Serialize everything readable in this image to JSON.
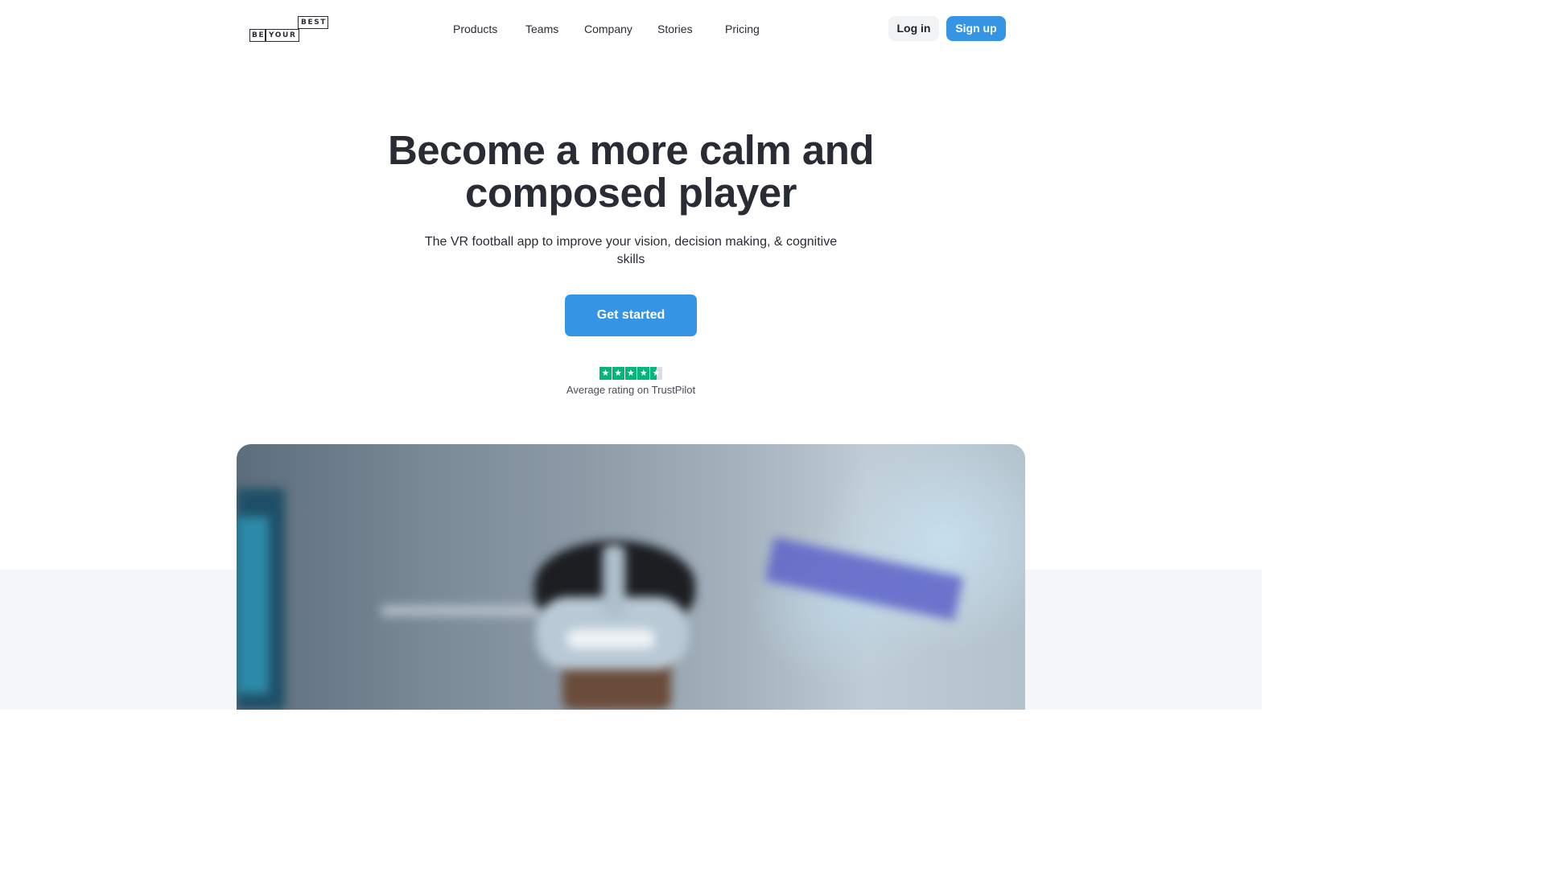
{
  "brand": {
    "logo_top": "BEST",
    "logo_left": "BE",
    "logo_right": "YOUR"
  },
  "nav": {
    "items": [
      {
        "label": "Products"
      },
      {
        "label": "Teams"
      },
      {
        "label": "Company"
      },
      {
        "label": "Stories"
      },
      {
        "label": "Pricing"
      }
    ],
    "login_label": "Log in",
    "signup_label": "Sign up"
  },
  "hero": {
    "headline_line1": "Become a more calm and",
    "headline_line2": "composed player",
    "subtitle": "The VR football app to improve your vision, decision making, & cognitive skills",
    "cta_label": "Get started",
    "rating": {
      "stars_filled": 4.5,
      "stars_max": 5,
      "label": "Average rating on TrustPilot"
    }
  },
  "colors": {
    "accent": "#3694e5",
    "trustpilot_green": "#00b67a",
    "text": "#2a2c35",
    "band": "#f5f6f8"
  }
}
